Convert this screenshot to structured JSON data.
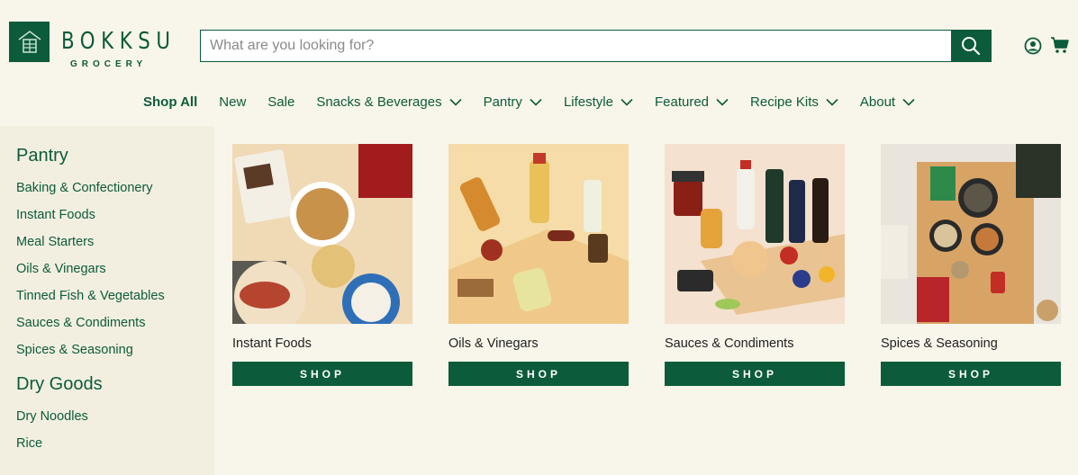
{
  "brand": {
    "name": "BOKKSU",
    "sub": "GROCERY",
    "color": "#0c5b3b"
  },
  "search": {
    "placeholder": "What are you looking for?",
    "icon": "search-icon"
  },
  "header_icons": [
    "account-icon",
    "cart-icon"
  ],
  "nav": [
    {
      "label": "Shop All",
      "active": true,
      "dropdown": false
    },
    {
      "label": "New",
      "dropdown": false
    },
    {
      "label": "Sale",
      "dropdown": false
    },
    {
      "label": "Snacks & Beverages",
      "dropdown": true
    },
    {
      "label": "Pantry",
      "dropdown": true
    },
    {
      "label": "Lifestyle",
      "dropdown": true
    },
    {
      "label": "Featured",
      "dropdown": true
    },
    {
      "label": "Recipe Kits",
      "dropdown": true
    },
    {
      "label": "About",
      "dropdown": true
    }
  ],
  "sidebar": {
    "groups": [
      {
        "heading": "Pantry",
        "items": [
          "Baking & Confectionery",
          "Instant Foods",
          "Meal Starters",
          "Oils & Vinegars",
          "Tinned Fish & Vegetables",
          "Sauces & Condiments",
          "Spices & Seasoning"
        ]
      },
      {
        "heading": "Dry Goods",
        "items": [
          "Dry Noodles",
          "Rice"
        ]
      }
    ]
  },
  "cards": [
    {
      "title": "Instant Foods",
      "button": "SHOP"
    },
    {
      "title": "Oils & Vinegars",
      "button": "SHOP"
    },
    {
      "title": "Sauces & Condiments",
      "button": "SHOP"
    },
    {
      "title": "Spices & Seasoning",
      "button": "SHOP"
    }
  ]
}
